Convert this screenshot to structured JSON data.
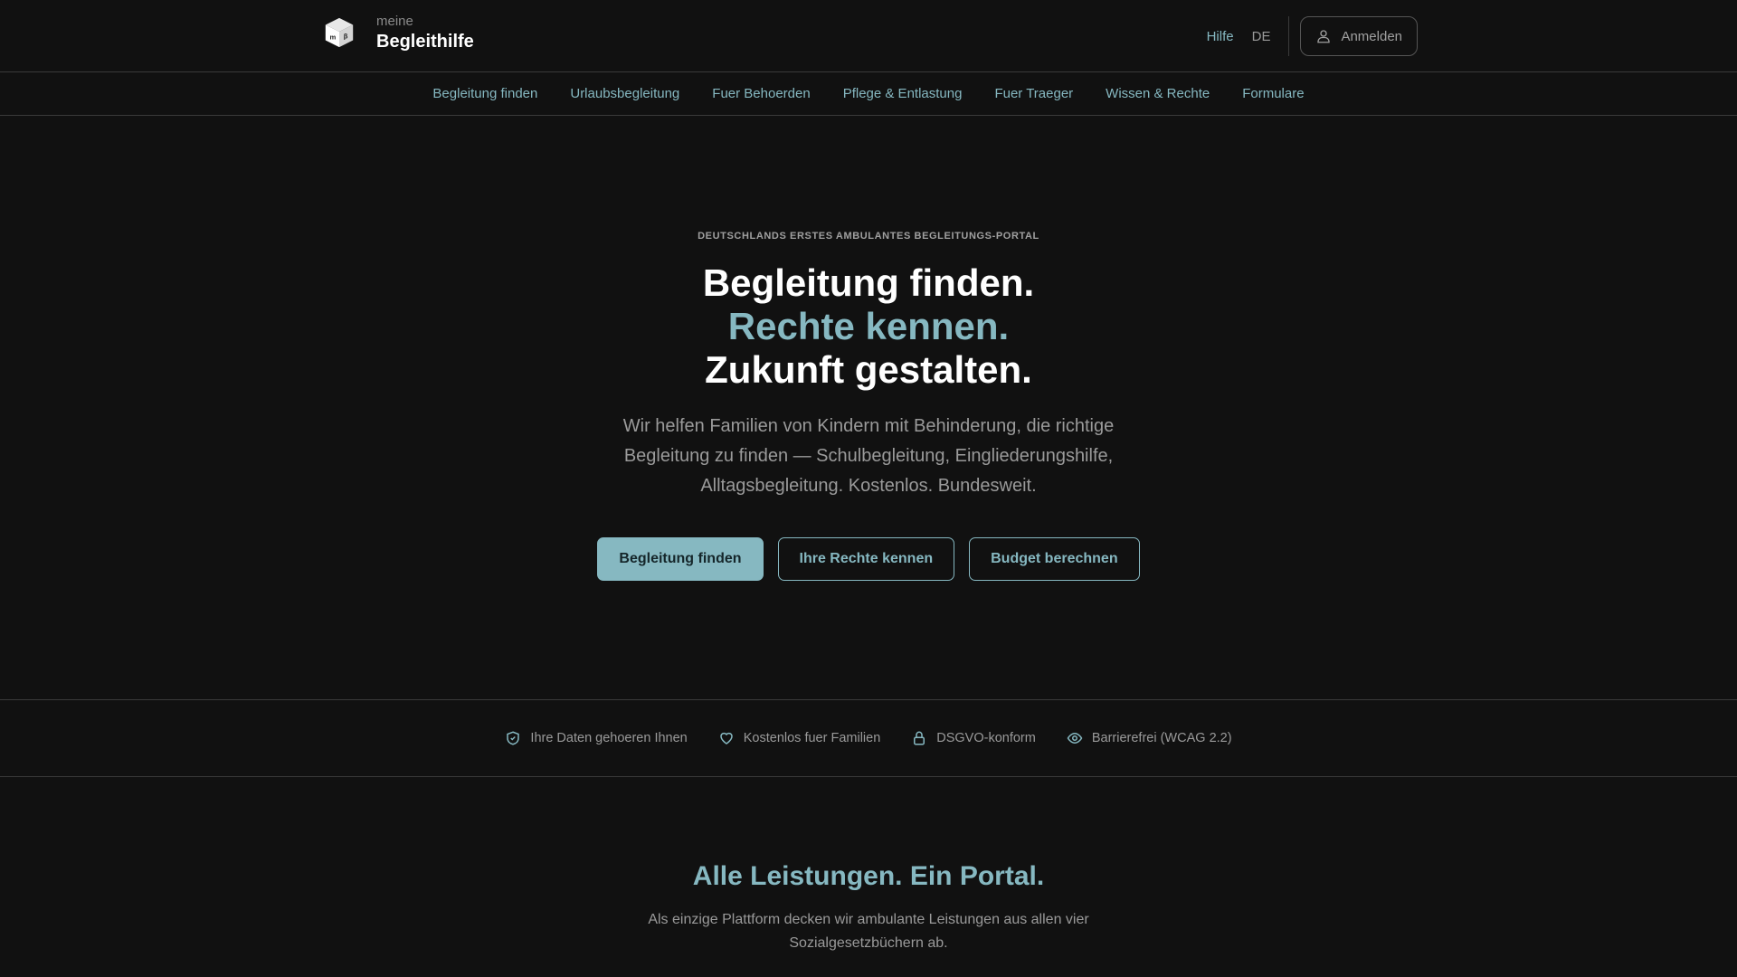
{
  "header": {
    "logo_small": "meine",
    "logo_big": "Begleithilfe",
    "help": "Hilfe",
    "lang": "DE",
    "login": "Anmelden"
  },
  "nav": [
    "Begleitung finden",
    "Urlaubsbegleitung",
    "Fuer Behoerden",
    "Pflege & Entlastung",
    "Fuer Traeger",
    "Wissen & Rechte",
    "Formulare"
  ],
  "hero": {
    "eyebrow": "Deutschlands erstes ambulantes Begleitungs-Portal",
    "line1": "Begleitung finden.",
    "line2": "Rechte kennen.",
    "line3": "Zukunft gestalten.",
    "lead": "Wir helfen Familien von Kindern mit Behinderung, die richtige Begleitung zu finden — Schulbegleitung, Eingliederungshilfe, Alltagsbegleitung. Kostenlos. Bundesweit.",
    "btn_primary": "Begleitung finden",
    "btn_rights": "Ihre Rechte kennen",
    "btn_budget": "Budget berechnen"
  },
  "trust": [
    {
      "icon": "shield-check-icon",
      "label": "Ihre Daten gehoeren Ihnen"
    },
    {
      "icon": "heart-icon",
      "label": "Kostenlos fuer Familien"
    },
    {
      "icon": "lock-icon",
      "label": "DSGVO-konform"
    },
    {
      "icon": "eye-icon",
      "label": "Barrierefrei (WCAG 2.2)"
    }
  ],
  "section": {
    "title": "Alle Leistungen. Ein Portal.",
    "text": "Als einzige Plattform decken wir ambulante Leistungen aus allen vier Sozialgesetzbüchern ab."
  },
  "colors": {
    "accent": "#86b8c1",
    "background": "#111111"
  }
}
